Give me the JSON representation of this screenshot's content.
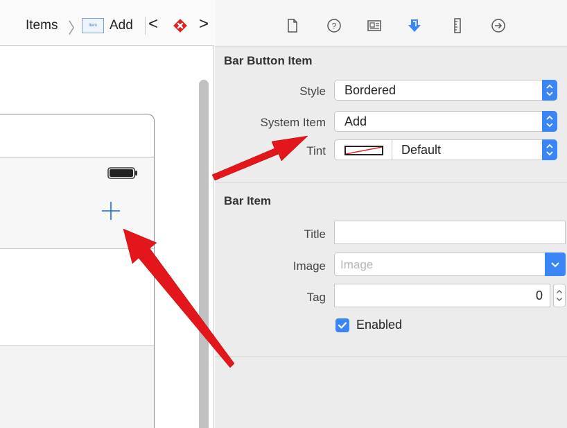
{
  "jumpbar": {
    "crumb_items": "Items",
    "crumb_add": "Add",
    "thumb_text": "Item"
  },
  "inspector": {
    "toolbar_icons": [
      "file-icon",
      "help-icon",
      "identity-icon",
      "attributes-icon",
      "size-icon",
      "connections-icon"
    ],
    "bar_button_item": {
      "title": "Bar Button Item",
      "style_label": "Style",
      "style_value": "Bordered",
      "system_item_label": "System Item",
      "system_item_value": "Add",
      "tint_label": "Tint",
      "tint_value": "Default"
    },
    "bar_item": {
      "title": "Bar Item",
      "title_label": "Title",
      "title_value": "",
      "image_label": "Image",
      "image_placeholder": "Image",
      "tag_label": "Tag",
      "tag_value": "0",
      "enabled_label": "Enabled",
      "enabled_checked": true
    }
  },
  "colors": {
    "accent": "#3b86f7",
    "annotation_arrow": "#e3161c",
    "plus_button": "#2f7ae5"
  }
}
